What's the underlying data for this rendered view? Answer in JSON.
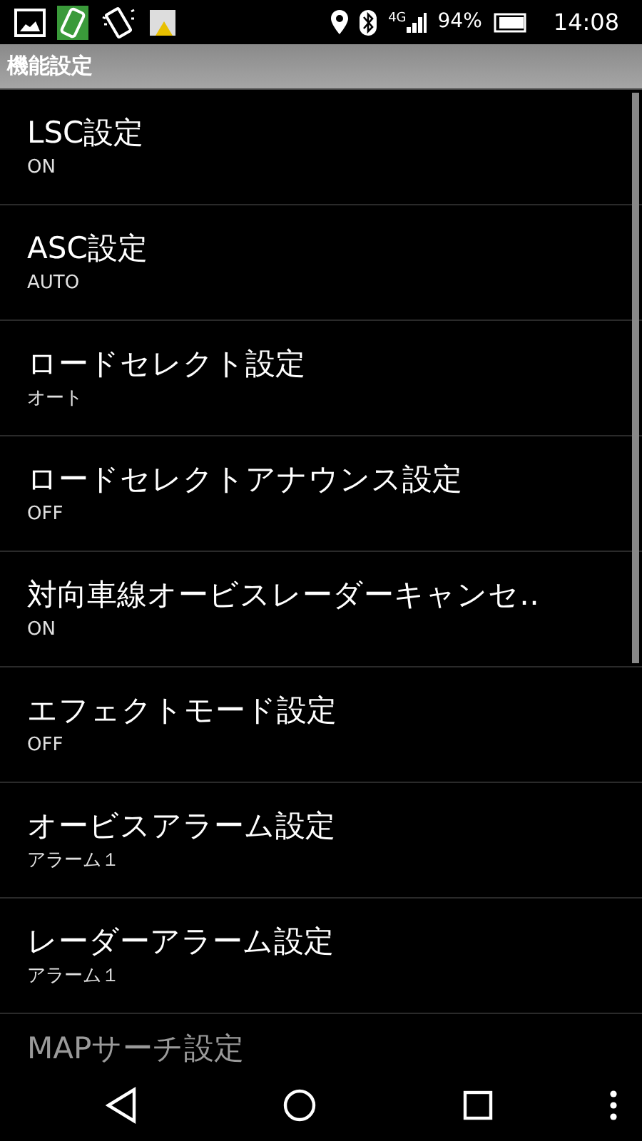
{
  "status_bar": {
    "battery_percent": "94%",
    "network": "4G",
    "time": "14:08"
  },
  "title_bar": {
    "title": "機能設定"
  },
  "settings": [
    {
      "title": "LSC設定",
      "value": "ON"
    },
    {
      "title": "ASC設定",
      "value": "AUTO"
    },
    {
      "title": "ロードセレクト設定",
      "value": "オート"
    },
    {
      "title": "ロードセレクトアナウンス設定",
      "value": "OFF"
    },
    {
      "title": "対向車線オービスレーダーキャンセ‥",
      "value": "ON"
    },
    {
      "title": "エフェクトモード設定",
      "value": "OFF"
    },
    {
      "title": "オービスアラーム設定",
      "value": "アラーム１"
    },
    {
      "title": "レーダーアラーム設定",
      "value": "アラーム１"
    },
    {
      "title": "MAPサーチ設定"
    }
  ]
}
